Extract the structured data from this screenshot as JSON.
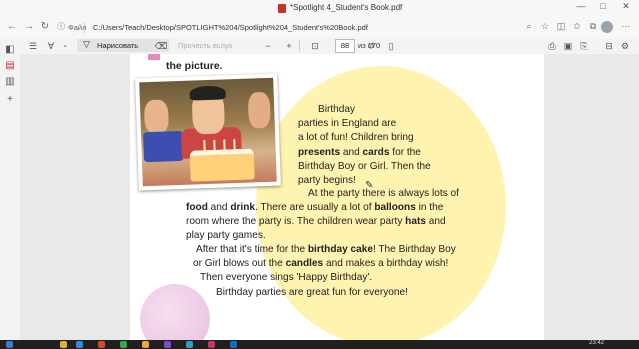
{
  "window": {
    "title": "*Spotlight 4_Student's Book.pdf",
    "controls": {
      "minimize": "—",
      "maximize": "□",
      "close": "✕"
    }
  },
  "address": {
    "scheme_label": "Файл",
    "url": "C:/Users/Teach/Desktop/SPOTLIGHT%204/Spotlight%204_Student's%20Book.pdf"
  },
  "toolbar": {
    "draw_label": "Нарисовать",
    "read_aloud_label": "Прочесть вслух",
    "zoom_out": "−",
    "zoom_in": "+",
    "current_page": "88",
    "page_of": "из 170"
  },
  "page": {
    "headline": "the picture.",
    "lines": [
      [
        "Birthday"
      ],
      [
        "parties in England are"
      ],
      [
        "a lot of fun! Children bring"
      ],
      [
        {
          "b": "presents"
        },
        " and ",
        {
          "b": "cards"
        },
        " for the"
      ],
      [
        "Birthday Boy or Girl.  Then  the"
      ],
      [
        "party begins!"
      ],
      [
        "At the party there is always lots of"
      ],
      [
        {
          "b": "food"
        },
        " and ",
        {
          "b": "drink"
        },
        ". There are usually a lot of ",
        {
          "b": "balloons"
        },
        " in the"
      ],
      [
        "room where the party is. The children wear party ",
        {
          "b": "hats"
        },
        " and"
      ],
      [
        "play party games."
      ],
      [
        "After that it's time for the ",
        {
          "b": "birthday cake"
        },
        "! The Birthday Boy"
      ],
      [
        "or Girl blows out the ",
        {
          "b": "candles"
        },
        " and makes a birthday wish!"
      ],
      [
        "Then everyone sings 'Happy Birthday'."
      ],
      [
        "Birthday  parties are great fun for everyone!"
      ]
    ]
  },
  "taskbar": {
    "time": "23:42"
  },
  "colors": {
    "yellow_blob": "#fff3b0",
    "accent_red": "#c8312b"
  }
}
